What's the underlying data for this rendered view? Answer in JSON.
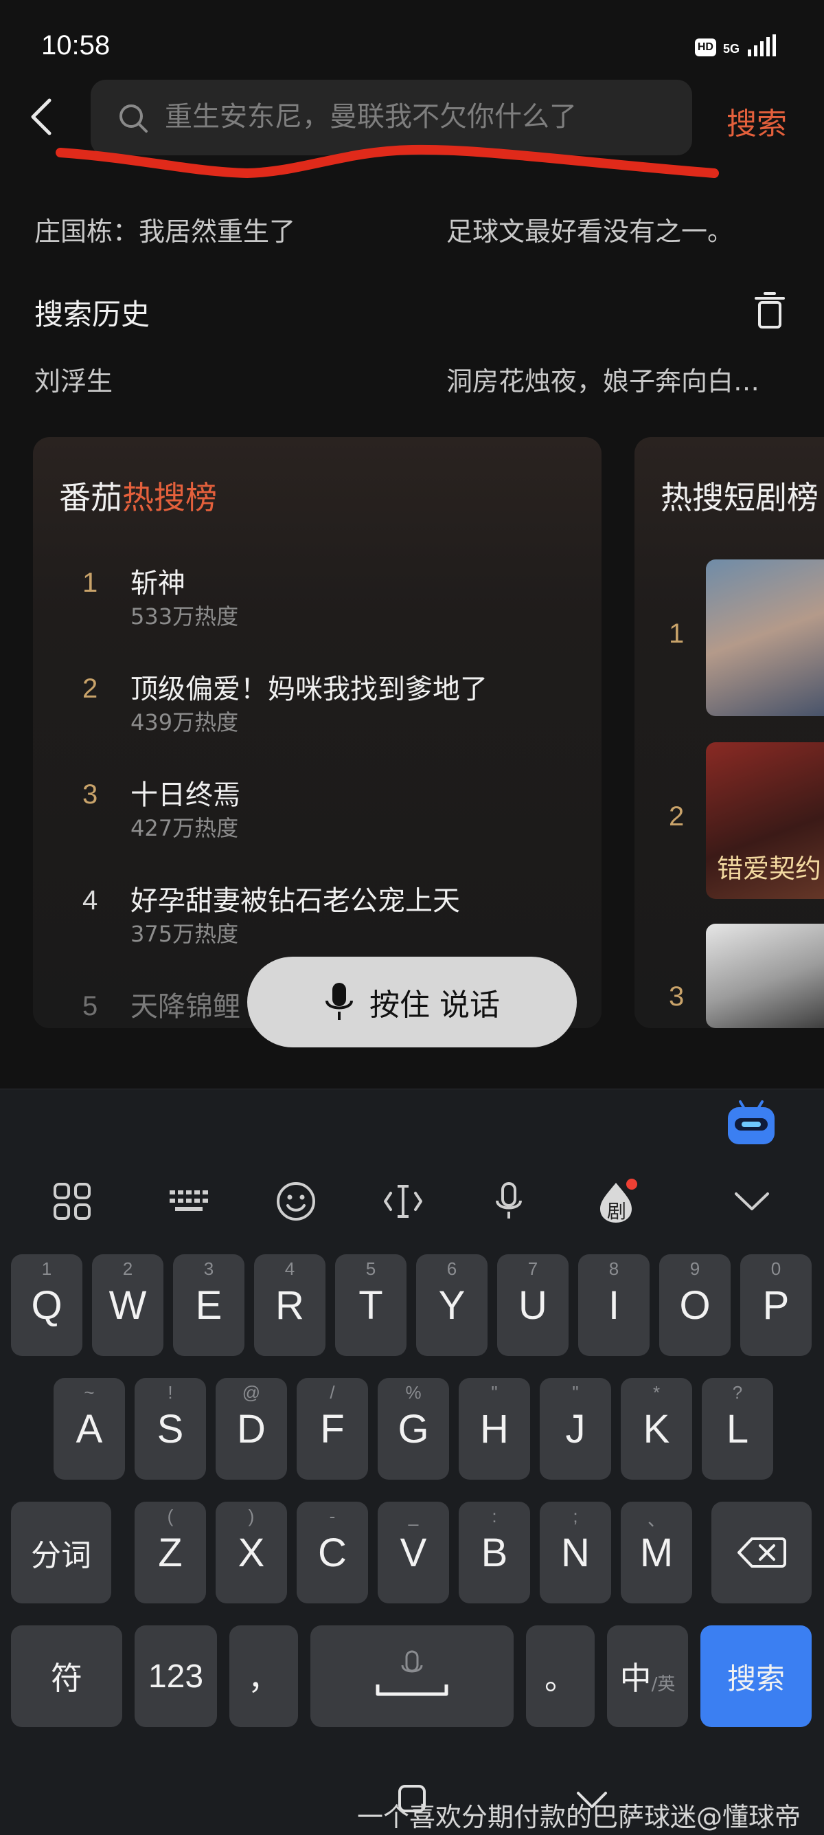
{
  "status": {
    "time": "10:58",
    "hd": "HD",
    "network": "5G"
  },
  "search": {
    "placeholder": "重生安东尼，曼联我不欠你什么了",
    "action_label": "搜索"
  },
  "suggestions": [
    {
      "left": "庄国栋：我居然重生了",
      "right": "足球文最好看没有之一。"
    }
  ],
  "history": {
    "title": "搜索历史",
    "items": [
      {
        "left": "刘浮生",
        "right": "洞房花烛夜，娘子奔向白…"
      }
    ]
  },
  "hot_search": {
    "title_plain": "番茄",
    "title_highlight": "热搜榜",
    "items": [
      {
        "rank": "1",
        "title": "斩神",
        "heat": "533万热度"
      },
      {
        "rank": "2",
        "title": "顶级偏爱！妈咪我找到爹地了",
        "heat": "439万热度"
      },
      {
        "rank": "3",
        "title": "十日终焉",
        "heat": "427万热度"
      },
      {
        "rank": "4",
        "title": "好孕甜妻被钻石老公宠上天",
        "heat": "375万热度"
      },
      {
        "rank": "5",
        "title": "天降锦鲤",
        "heat": ""
      }
    ]
  },
  "drama_board": {
    "title": "热搜短剧榜",
    "items": [
      {
        "rank": "1"
      },
      {
        "rank": "2",
        "poster_text": "错爱契约"
      },
      {
        "rank": "3"
      }
    ]
  },
  "voice": {
    "label": "按住 说话"
  },
  "keyboard": {
    "row1": [
      {
        "main": "Q",
        "sub": "1"
      },
      {
        "main": "W",
        "sub": "2"
      },
      {
        "main": "E",
        "sub": "3"
      },
      {
        "main": "R",
        "sub": "4"
      },
      {
        "main": "T",
        "sub": "5"
      },
      {
        "main": "Y",
        "sub": "6"
      },
      {
        "main": "U",
        "sub": "7"
      },
      {
        "main": "I",
        "sub": "8"
      },
      {
        "main": "O",
        "sub": "9"
      },
      {
        "main": "P",
        "sub": "0"
      }
    ],
    "row2": [
      {
        "main": "A",
        "sub": "~"
      },
      {
        "main": "S",
        "sub": "!"
      },
      {
        "main": "D",
        "sub": "@"
      },
      {
        "main": "F",
        "sub": "/"
      },
      {
        "main": "G",
        "sub": "%"
      },
      {
        "main": "H",
        "sub": "\""
      },
      {
        "main": "J",
        "sub": "\""
      },
      {
        "main": "K",
        "sub": "*"
      },
      {
        "main": "L",
        "sub": "?"
      }
    ],
    "row3": [
      {
        "main": "Z",
        "sub": "("
      },
      {
        "main": "X",
        "sub": ")"
      },
      {
        "main": "C",
        "sub": "-"
      },
      {
        "main": "V",
        "sub": "_"
      },
      {
        "main": "B",
        "sub": ":"
      },
      {
        "main": "N",
        "sub": ";"
      },
      {
        "main": "M",
        "sub": "、"
      }
    ],
    "fenci": "分词",
    "fu": "符",
    "num": "123",
    "comma": "，",
    "period": "。",
    "lang_main": "中",
    "lang_sub": "/英",
    "search_key": "搜索",
    "drama_badge": "剧"
  },
  "watermark": "一个喜欢分期付款的巴萨球迷@懂球帝",
  "colors": {
    "accent": "#e4603c",
    "key_search": "#3b7ff2",
    "rank_gold": "#c9a36a"
  }
}
